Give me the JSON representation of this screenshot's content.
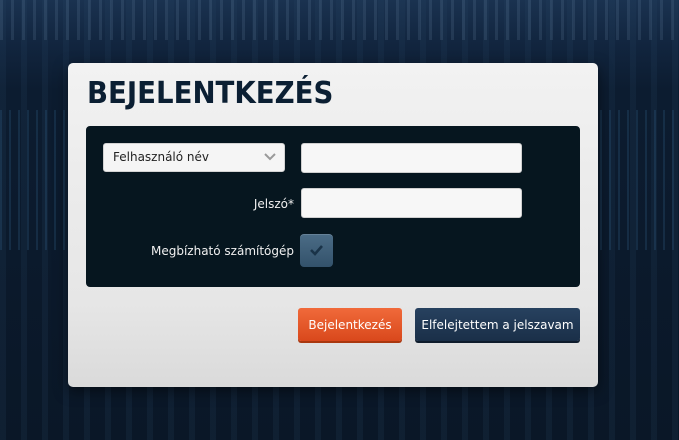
{
  "page": {
    "title": "BEJELENTKEZÉS"
  },
  "form": {
    "username_type": {
      "selected": "Felhasználó név"
    },
    "username": {
      "value": "",
      "placeholder": ""
    },
    "password_label": "Jelszó*",
    "password": {
      "value": "",
      "placeholder": ""
    },
    "trusted_label": "Megbízható számítógép",
    "trusted_checked": true
  },
  "buttons": {
    "login": "Bejelentkezés",
    "forgot": "Elfelejtettem a jelszavam"
  },
  "colors": {
    "accent": "#e0531f",
    "dark_button": "#1e3550",
    "panel": "#06161f",
    "title": "#0b1f33"
  },
  "icons": {
    "dropdown": "chevron-down-icon",
    "check": "check-icon"
  }
}
